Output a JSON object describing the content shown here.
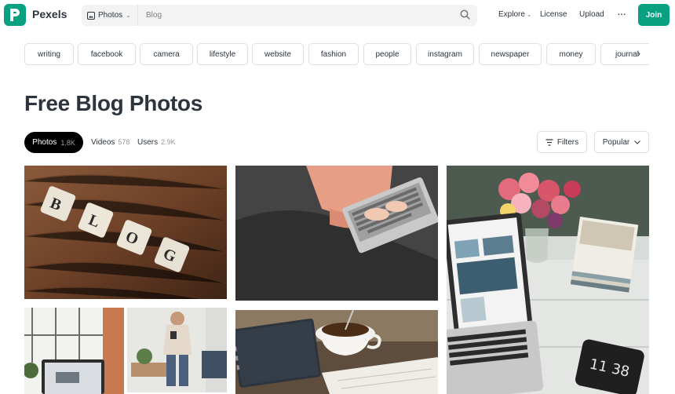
{
  "header": {
    "brand": "Pexels",
    "search_type": "Photos",
    "search_value": "Blog",
    "nav": {
      "explore": "Explore",
      "license": "License",
      "upload": "Upload"
    },
    "join_label": "Join",
    "colors": {
      "brand": "#07a081"
    }
  },
  "chips": [
    "writing",
    "facebook",
    "camera",
    "lifestyle",
    "website",
    "fashion",
    "people",
    "instagram",
    "newspaper",
    "money",
    "journal"
  ],
  "page_title": "Free Blog Photos",
  "tabs": [
    {
      "label": "Photos",
      "count": "1.8K",
      "active": true
    },
    {
      "label": "Videos",
      "count": "578"
    },
    {
      "label": "Users",
      "count": "2.9K"
    }
  ],
  "toolbar": {
    "filters_label": "Filters",
    "sort_label": "Popular"
  },
  "photos": [
    {
      "name": "photo-blog-tiles",
      "subject": "scrabble tiles spelling blog on wood"
    },
    {
      "name": "photo-laptop-typing",
      "subject": "person typing on laptop"
    },
    {
      "name": "photo-flowers-laptop",
      "subject": "laptop with flowers and magazines"
    },
    {
      "name": "photo-laptop-window",
      "subject": "laptop near window"
    },
    {
      "name": "photo-woman-phone",
      "subject": "woman using phone in room"
    },
    {
      "name": "photo-coffee-notebook",
      "subject": "coffee cup and notebook"
    }
  ],
  "photo_overlay_text": "11 38"
}
